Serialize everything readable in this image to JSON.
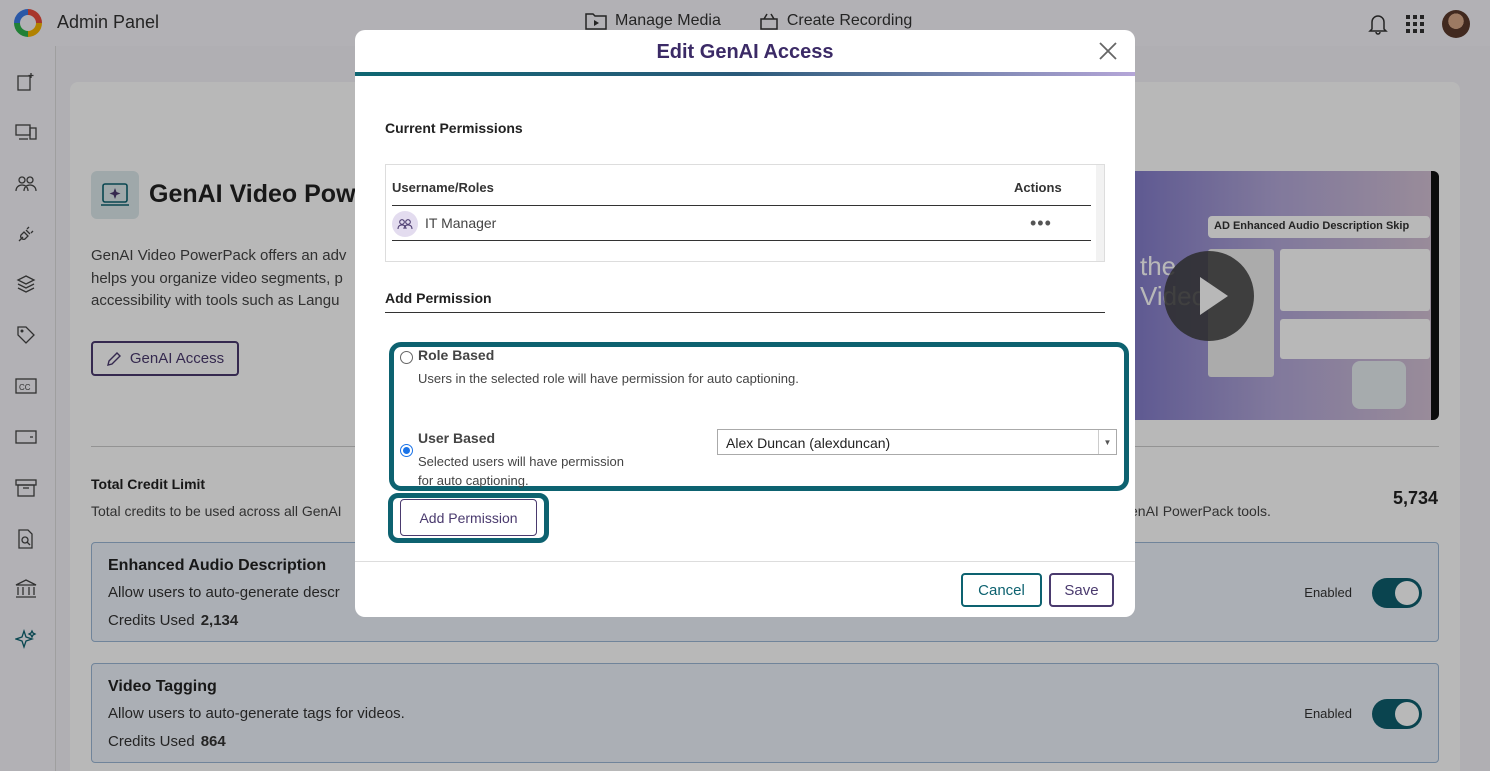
{
  "app": {
    "title": "Admin Panel"
  },
  "top_nav": {
    "manage_media": "Manage Media",
    "create_recording": "Create Recording"
  },
  "sidebar": {
    "items": [
      "doc-add-icon",
      "devices-icon",
      "users-icon",
      "plug-icon",
      "layers-icon",
      "tag-icon",
      "cc-icon",
      "card-icon",
      "archive-icon",
      "file-search-icon",
      "bank-icon",
      "sparkle-icon"
    ]
  },
  "powerpack": {
    "title": "GenAI Video Powe",
    "description_lines": [
      "GenAI Video PowerPack offers an adv",
      "helps you organize video segments, p",
      "accessibility with tools such as Langu"
    ],
    "access_button": "GenAI Access"
  },
  "credits": {
    "title": "Total Credit Limit",
    "desc_left": "Total credits to be used across all GenAI",
    "desc_right": "enAI PowerPack tools.",
    "total": "5,734"
  },
  "tools": [
    {
      "title": "Enhanced Audio Description",
      "desc": "Allow users to auto-generate descr",
      "credits_label": "Credits Used",
      "credits_value": "2,134",
      "status": "Enabled"
    },
    {
      "title": "Video Tagging",
      "desc": "Allow users to auto-generate tags for videos.",
      "credits_label": "Credits Used",
      "credits_value": "864",
      "status": "Enabled"
    }
  ],
  "preview": {
    "text_line1": "the",
    "text_line2": "Video",
    "header": "AD Enhanced Audio Description   Skip"
  },
  "modal": {
    "title": "Edit GenAI Access",
    "current_permissions_title": "Current Permissions",
    "table": {
      "col_name": "Username/Roles",
      "col_actions": "Actions",
      "rows": [
        {
          "name": "IT Manager",
          "actions": "•••"
        }
      ]
    },
    "add_permission_title": "Add Permission",
    "role_based": {
      "label": "Role Based",
      "desc": "Users in the selected role will have permission for auto captioning.",
      "checked": false
    },
    "user_based": {
      "label": "User Based",
      "desc_line1": "Selected users will have permission",
      "desc_line2": "for auto captioning.",
      "checked": true
    },
    "user_select": {
      "value": "Alex Duncan (alexduncan)"
    },
    "add_button": "Add Permission",
    "cancel_button": "Cancel",
    "save_button": "Save"
  },
  "colors": {
    "accent": "#0d6270",
    "brand_purple": "#4a3a6e",
    "title_purple": "#3b2a66"
  }
}
